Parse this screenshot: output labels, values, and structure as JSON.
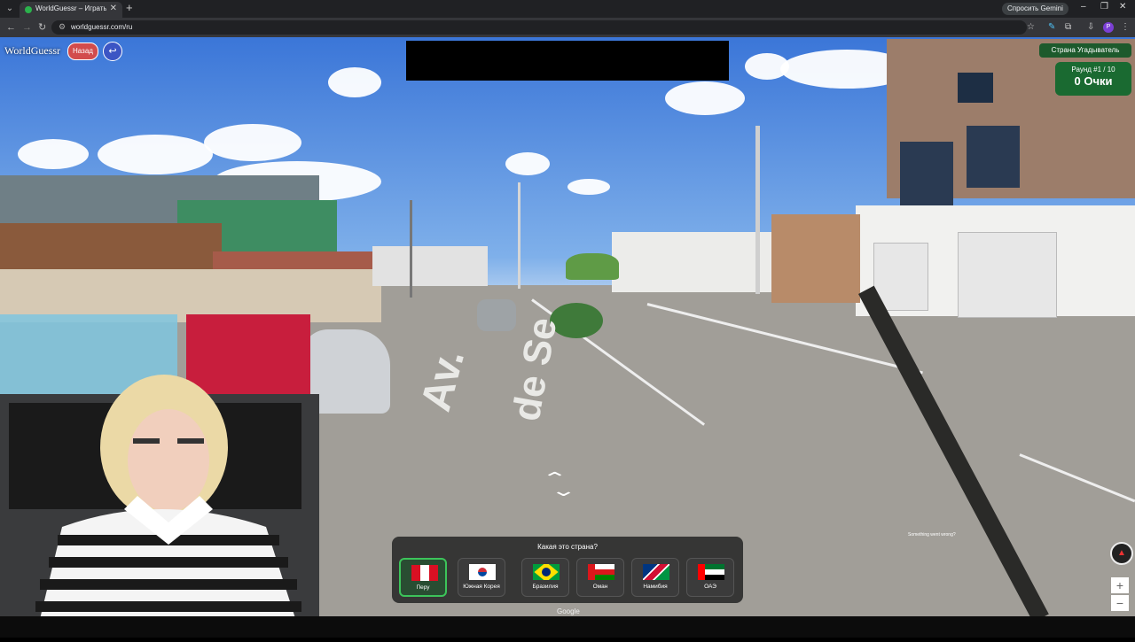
{
  "browser": {
    "tab_title": "WorldGuessr – Играть в Ge",
    "gemini_label": "Спросить Gemini",
    "url": "worldguessr.com/ru",
    "profile_initial": "P"
  },
  "game": {
    "logo": "WorldGuessr",
    "back_label": "Назад",
    "mode_label": "Страна Угадыватель",
    "round_label": "Раунд #1 / 10",
    "points_label": "0 Очки",
    "error_note": "Something went wrong?",
    "google_label": "Google"
  },
  "scene": {
    "road_text_1": "Av.",
    "road_text_2": "de Se"
  },
  "quiz": {
    "question": "Какая это страна?",
    "options": [
      {
        "label": "Перу",
        "flag": "peru",
        "selected": true
      },
      {
        "label": "Южная Корея",
        "flag": "south-korea",
        "selected": false
      },
      {
        "label": "Бразилия",
        "flag": "brazil",
        "selected": false
      },
      {
        "label": "Оман",
        "flag": "oman",
        "selected": false
      },
      {
        "label": "Намибия",
        "flag": "namibia",
        "selected": false
      },
      {
        "label": "ОАЭ",
        "flag": "uae",
        "selected": false
      }
    ]
  },
  "colors": {
    "accent_green": "#3cc45a",
    "back_red": "#d24c4c",
    "return_blue": "#3c55c4",
    "score_green": "#1a6a31"
  }
}
